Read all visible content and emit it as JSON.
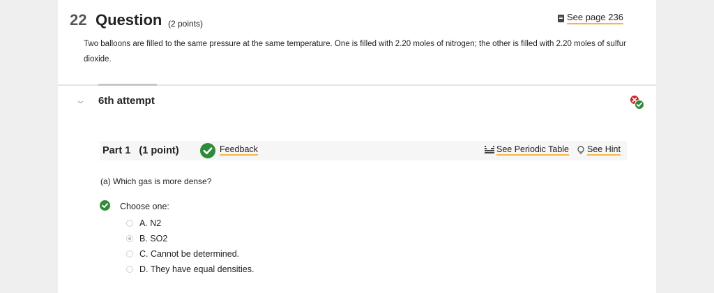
{
  "question": {
    "number": "22",
    "title": "Question",
    "points": "(2 points)",
    "see_page": "See page 236",
    "text": "Two balloons are filled to the same pressure at the same temperature. One is filled with 2.20 moles of nitrogen; the other is filled with 2.20 moles of sulfur dioxide."
  },
  "attempt": {
    "label": "6th attempt",
    "status_icon": "incorrect-then-correct-icon"
  },
  "part": {
    "title": "Part 1",
    "points": "(1 point)",
    "feedback_label": "Feedback",
    "periodic_label": "See Periodic Table",
    "hint_label": "See Hint",
    "prompt": "(a) Which gas is more dense?",
    "choose_label": "Choose one:",
    "options": [
      {
        "label": "A. N2",
        "selected": false
      },
      {
        "label": "B. SO2",
        "selected": true
      },
      {
        "label": "C. Cannot be determined.",
        "selected": false
      },
      {
        "label": "D. They have equal densities.",
        "selected": false
      }
    ]
  },
  "colors": {
    "correct": "#2e8b3a",
    "incorrect": "#c62828",
    "link_underline": "#f2b84b"
  }
}
